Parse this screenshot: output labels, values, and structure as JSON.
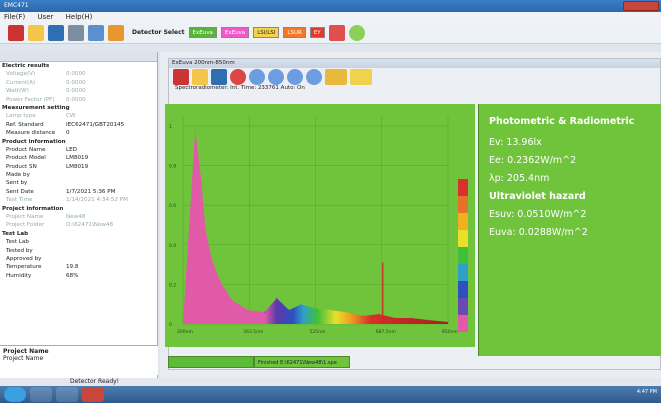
{
  "window": {
    "title": "EMC471"
  },
  "menu": [
    "File(F)",
    "User",
    "Help(H)"
  ],
  "toolbar": {
    "detector_label": "Detector Select",
    "detector_value": "ExEuva",
    "pills": [
      "ExEuva",
      "LSI/LSI",
      "LSUR",
      "EY"
    ]
  },
  "left": {
    "sections": [
      {
        "title": "Electric results",
        "rows": [
          [
            "Voltage(V)",
            "0.0000",
            true
          ],
          [
            "Current(A)",
            "0.0000",
            true
          ],
          [
            "Watt(W)",
            "0.0000",
            true
          ],
          [
            "Power Factor (PF)",
            "0.0000",
            true
          ]
        ]
      },
      {
        "title": "Measurement setting",
        "rows": [
          [
            "Lamp type",
            "CW",
            true
          ],
          [
            "Ref. Standard",
            "IEC62471/GBT20145",
            false
          ],
          [
            "Measure distance",
            "0",
            false
          ]
        ]
      },
      {
        "title": "Product information",
        "rows": [
          [
            "Product Name",
            "LED",
            false
          ],
          [
            "Product Model",
            "LM8019",
            false
          ],
          [
            "Product SN",
            "LM8019",
            false
          ],
          [
            "Made by",
            "",
            false
          ],
          [
            "Sent by",
            "",
            false
          ],
          [
            "Sent Date",
            "1/7/2021 5:36 PM",
            false
          ],
          [
            "Test Time",
            "1/14/2021 4:34:52 PM",
            true
          ]
        ]
      },
      {
        "title": "Project information",
        "rows": [
          [
            "Project Name",
            "New48",
            true
          ],
          [
            "Project Folder",
            "D:\\62471\\New48",
            true
          ]
        ]
      },
      {
        "title": "Test Lab",
        "rows": [
          [
            "Test Lab",
            "",
            false
          ],
          [
            "Tested by",
            "",
            false
          ],
          [
            "Approved by",
            "",
            false
          ],
          [
            "Temperature",
            "19.8",
            false
          ],
          [
            "Humidity",
            "68%",
            false
          ]
        ]
      }
    ],
    "project_title": "Project Name",
    "project_value": "Project Name"
  },
  "inner": {
    "title": "ExEuva 200nm-850nm",
    "subtitle": "Spectroradiometer:  Int. Time: 233761        Auto: On"
  },
  "chart_data": {
    "type": "area",
    "title": "",
    "x_ticks": [
      "200nm",
      "363.5nm",
      "525nm",
      "687.5nm",
      "850nm"
    ],
    "y_ticks": [
      "1",
      "0.8",
      "0.6",
      "0.4",
      "0.2",
      "0"
    ],
    "x": [
      200,
      230,
      245,
      255,
      270,
      290,
      320,
      360,
      400,
      430,
      460,
      490,
      520,
      560,
      600,
      640,
      680,
      720,
      760,
      800,
      850
    ],
    "y": [
      0.0,
      0.98,
      0.72,
      0.48,
      0.33,
      0.22,
      0.12,
      0.07,
      0.06,
      0.13,
      0.07,
      0.1,
      0.08,
      0.07,
      0.06,
      0.04,
      0.05,
      0.03,
      0.03,
      0.02,
      0.01
    ],
    "spike": {
      "x": 690,
      "y": 0.31
    }
  },
  "results": {
    "title": "Photometric & Radiometric",
    "ev": "Ev: 13.96lx",
    "ee": "Ee: 0.2362W/m^2",
    "lp": "λp: 205.4nm",
    "uv_title": "Ultraviolet hazard",
    "esuv": "Esuv: 0.0510W/m^2",
    "euva": "Euva: 0.0288W/m^2"
  },
  "progress": {
    "text": "Finished E:\\62471\\New48\\1.spe"
  },
  "status": {
    "text": "Detector Ready!"
  },
  "clock": "4:47 PM"
}
